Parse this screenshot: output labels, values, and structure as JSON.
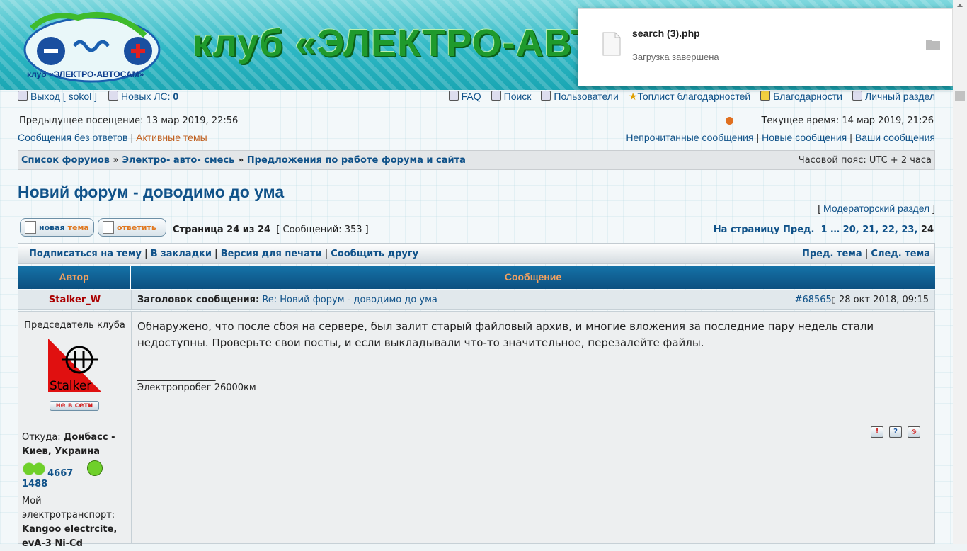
{
  "header": {
    "logo_text": "клуб «ЭЛЕКТРО-АВТОСАМ»",
    "banner_title": "клуб «ЭЛЕКТРО-АВТОСАМ»"
  },
  "download": {
    "file_name": "search (3).php",
    "status": "Загрузка завершена"
  },
  "topnav": {
    "logout": "Выход",
    "username": "sokol",
    "new_pm_label": "Новых ЛС:",
    "new_pm_count": "0",
    "faq": "FAQ",
    "search": "Поиск",
    "users": "Пользователи",
    "toplist": "Топлист благодарностей",
    "thanks": "Благодарности",
    "ucp": "Личный раздел"
  },
  "info": {
    "last_visit": "Предыдущее посещение: 13 мар 2019, 22:56",
    "current_time": "Текущее время: 14 мар 2019, 21:26"
  },
  "links": {
    "unanswered": "Сообщения без ответов",
    "active": "Активные темы",
    "unread": "Непрочитанные сообщения",
    "new_posts": "Новые сообщения",
    "your_posts": "Ваши сообщения"
  },
  "breadcrumb": {
    "items": [
      "Список форумов",
      "Электро- авто- смесь",
      "Предложения по работе форума и сайта"
    ],
    "timezone": "Часовой пояс: UTC + 2 часа"
  },
  "topic": {
    "title": "Новий форум - доводимо до ума",
    "mod_section": "Модераторский раздел"
  },
  "actions": {
    "new_topic_a": "новая",
    "new_topic_b": "тема",
    "reply": "ответить",
    "page_info": "Страница 24 из 24",
    "post_count": "Сообщений: 353",
    "goto_label": "На страницу",
    "prev": "Пред.",
    "pages": [
      "1",
      "…",
      "20",
      "21",
      "22",
      "23",
      "24"
    ]
  },
  "toolbar": {
    "subscribe": "Подписаться на тему",
    "bookmark": "В закладки",
    "print": "Версия для печати",
    "email": "Сообщить другу",
    "prev_topic": "Пред. тема",
    "next_topic": "След. тема"
  },
  "table": {
    "col_author": "Автор",
    "col_message": "Сообщение"
  },
  "post": {
    "author": "Stalker_W",
    "subject_label": "Заголовок сообщения:",
    "subject": "Re: Новий форум - доводимо до ума",
    "post_id": "#68565",
    "date": "28 окт 2018, 09:15",
    "rank": "Председатель клуба",
    "avatar_text": "Stalker",
    "status": "не в сети",
    "from_label": "Откуда:",
    "from_value": "Донбасс - Киев, Украина",
    "thanks_given": "4667",
    "thanks_received": "1488",
    "transport_label": "Мой электротранспорт:",
    "transport_value": "Kangoo electrcite, evA-3 Ni-Cd",
    "message": "Обнаружено, что после сбоя на сервере, был залит старый файловый архив, и многие вложения за последние пару недель стали недоступны. Проверьте свои посты, и если выкладывали что-то значительное, перезалейте файлы.",
    "signature_line": "_________________",
    "signature": "Электропробег 26000км"
  },
  "colors": {
    "link": "#105289",
    "author": "#aa0000",
    "header_orange": "#f0a060"
  }
}
